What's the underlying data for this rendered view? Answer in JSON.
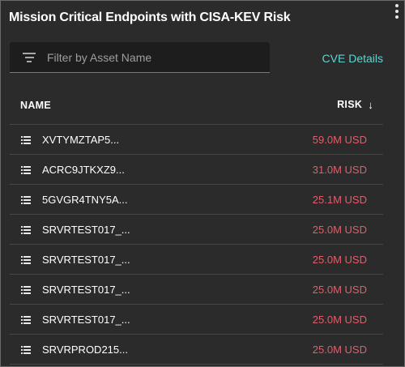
{
  "widget": {
    "title": "Mission Critical Endpoints with CISA-KEV Risk",
    "menu_icon": "more-vert-icon"
  },
  "filter": {
    "placeholder": "Filter by Asset Name",
    "value": "",
    "icon": "filter-list-icon"
  },
  "link": {
    "cve_details": "CVE Details"
  },
  "table": {
    "columns": {
      "name": "NAME",
      "risk": "RISK",
      "sort_indicator": "↓"
    },
    "row_icon": "list-icon",
    "rows": [
      {
        "name": "XVTYMZTAP5...",
        "risk": "59.0M USD"
      },
      {
        "name": "ACRC9JTKXZ9...",
        "risk": "31.0M USD"
      },
      {
        "name": "5GVGR4TNY5A...",
        "risk": "25.1M USD"
      },
      {
        "name": "SRVRTEST017_...",
        "risk": "25.0M USD"
      },
      {
        "name": "SRVRTEST017_...",
        "risk": "25.0M USD"
      },
      {
        "name": "SRVRTEST017_...",
        "risk": "25.0M USD"
      },
      {
        "name": "SRVRTEST017_...",
        "risk": "25.0M USD"
      },
      {
        "name": "SRVRPROD215...",
        "risk": "25.0M USD"
      }
    ]
  },
  "colors": {
    "background": "#2b2b2b",
    "accent_link": "#5cd6d2",
    "risk_value": "#e35d6a"
  }
}
